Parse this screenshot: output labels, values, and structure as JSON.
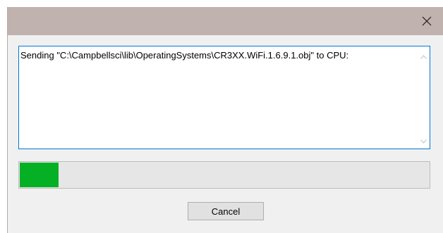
{
  "dialog": {
    "message": "Sending \"C:\\Campbellsci\\lib\\OperatingSystems\\CR3XX.WiFi.1.6.9.1.obj\" to CPU:",
    "progress_fraction": 0.095,
    "progress_color": "#06b025",
    "cancel_label": "Cancel",
    "close_icon": "close-icon"
  }
}
